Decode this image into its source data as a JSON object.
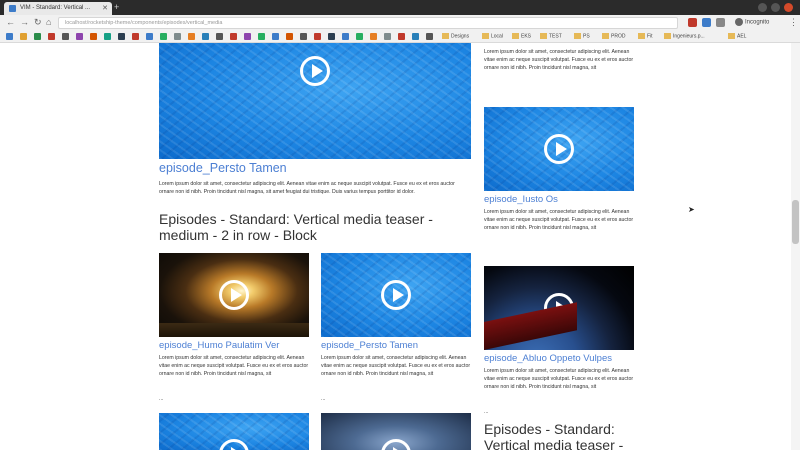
{
  "browser": {
    "tab_title": "VIM - Standard: Vertical ...",
    "url": "localhost/rocketship-theme/components/episodes/vertical_media",
    "account": "Incognito",
    "bookmarks": [
      "Designs",
      "Local",
      "EKS",
      "TEST",
      "PS",
      "PROD",
      "Fit",
      "Ingenieurs.p...",
      "AEL"
    ]
  },
  "content": {
    "blocks": [
      {
        "id": "left-top",
        "title": "episode_Persto Tamen",
        "text": "Lorem ipsum dolor sit amet, consectetur adipiscing elit. Aenean vitae enim ac neque suscipit volutpat. Fusce eu ex et eros auctor ornare non id nibh. Proin tincidunt nisl magna, sit amet feugiat dui tristique. Duis varius tempus porttitor id dolor.",
        "media": "water"
      },
      {
        "id": "right-top",
        "text": "Lorem ipsum dolor sit amet, consectetur adipiscing elit. Aenean vitae enim ac neque suscipit volutpat. Fusce eu ex et eros auctor ornare non id nibh. Proin tincidunt nisl magna, sit"
      },
      {
        "id": "right-2",
        "title": "episode_Iusto Os",
        "text": "Lorem ipsum dolor sit amet, consectetur adipiscing elit. Aenean vitae enim ac neque suscipit volutpat. Fusce eu ex et eros auctor ornare non id nibh. Proin tincidunt nisl magna, sit",
        "media": "water"
      },
      {
        "id": "right-3",
        "title": "episode_Abluo Oppeto Vulpes",
        "text": "Lorem ipsum dolor sit amet, consectetur adipiscing elit. Aenean vitae enim ac neque suscipit volutpat. Fusce eu ex et eros auctor ornare non id nibh. Proin tincidunt nisl magna, sit",
        "media": "space"
      },
      {
        "id": "grid-1",
        "title": "episode_Humo Paulatim Ver",
        "text": "Lorem ipsum dolor sit amet, consectetur adipiscing elit. Aenean vitae enim ac neque suscipit volutpat. Fusce eu ex et eros auctor ornare non id nibh. Proin tincidunt nisl magna, sit",
        "media": "rocket"
      },
      {
        "id": "grid-2",
        "title": "episode_Persto Tamen",
        "text": "Lorem ipsum dolor sit amet, consectetur adipiscing elit. Aenean vitae enim ac neque suscipit volutpat. Fusce eu ex et eros auctor ornare non id nibh. Proin tincidunt nisl magna, sit",
        "media": "water"
      }
    ],
    "section_heading_1": "Episodes - Standard: Vertical media teaser - medium - 2 in row - Block",
    "section_heading_2": "Episodes - Standard: Vertical media teaser -",
    "ellipsis": "..."
  },
  "colors": {
    "link": "#4c7fd3",
    "text": "#333333"
  }
}
